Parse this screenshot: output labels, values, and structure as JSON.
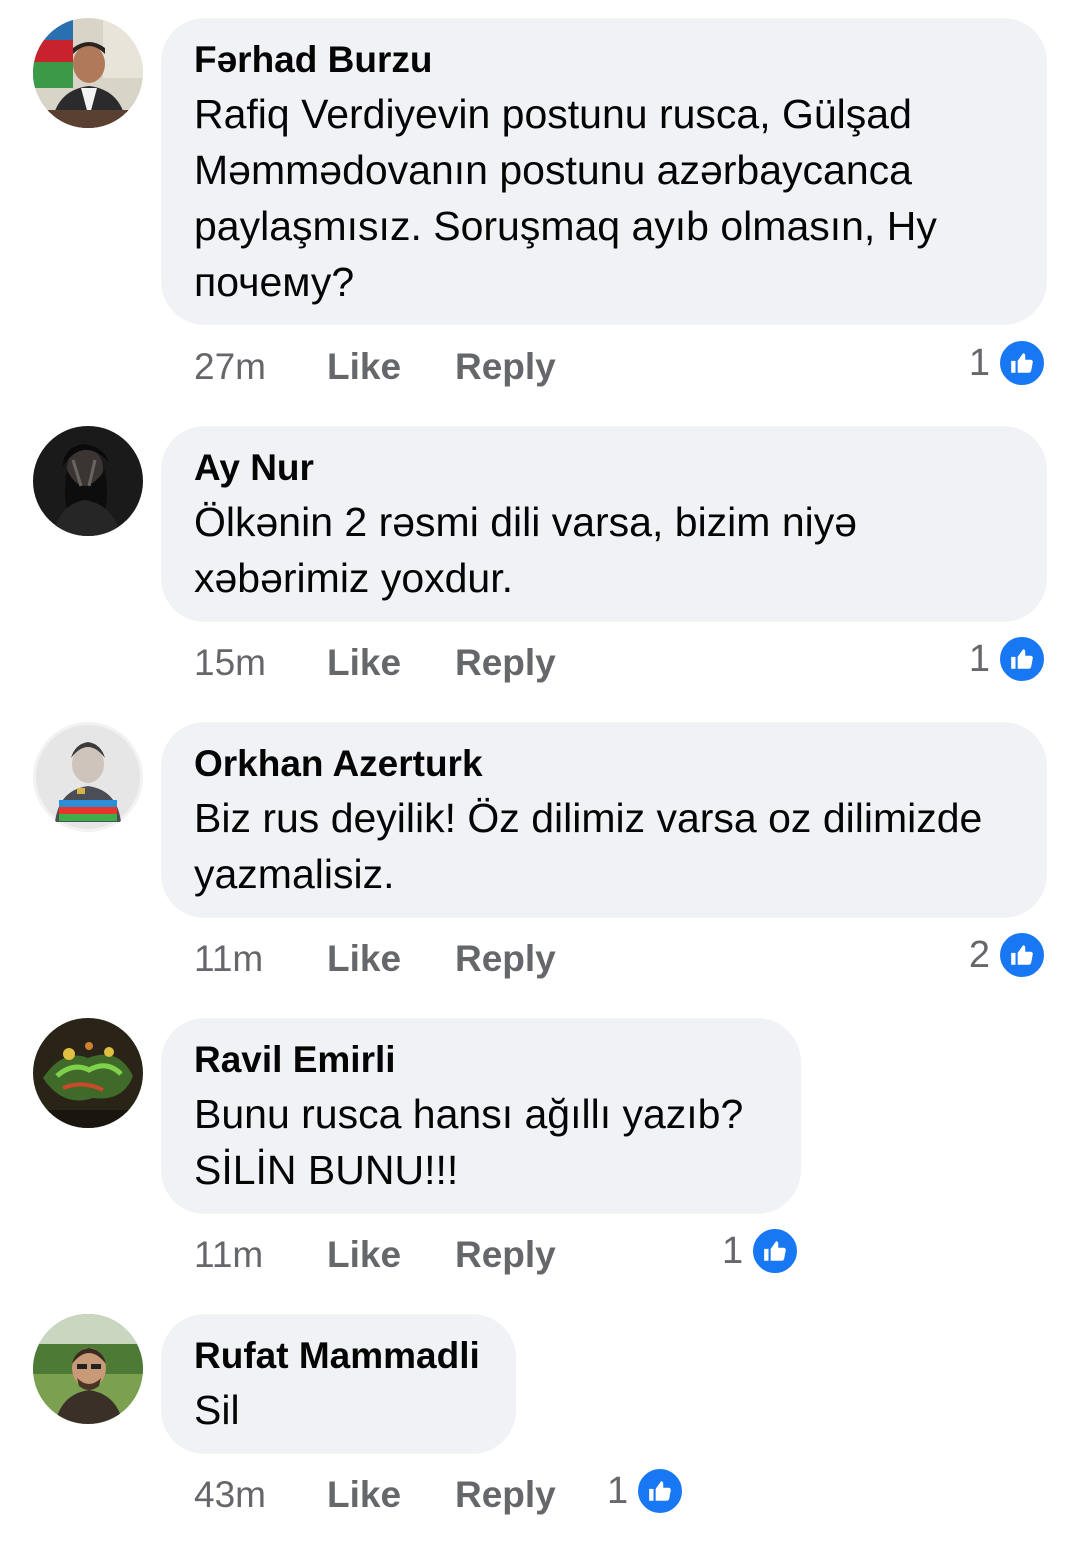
{
  "comments": [
    {
      "author": "Fərhad Burzu",
      "text": "Rafiq Verdiyevin postunu rusca, Gülşad Məmmədovanın postunu azərbaycanca paylaşmısız. Soruşmaq ayıb olmasın, Ну почему?",
      "time": "27m",
      "like_label": "Like",
      "reply_label": "Reply",
      "reaction_count": "1",
      "reaction_icon": "thumbs-up-icon"
    },
    {
      "author": "Ay Nur",
      "text": "Ölkənin 2 rəsmi dili varsa, bizim niyə xəbərimiz yoxdur.",
      "time": "15m",
      "like_label": "Like",
      "reply_label": "Reply",
      "reaction_count": "1",
      "reaction_icon": "thumbs-up-icon"
    },
    {
      "author": "Orkhan Azerturk",
      "text": "Biz rus deyilik! Öz dilimiz varsa oz dilimizde yazmalisiz.",
      "time": "11m",
      "like_label": "Like",
      "reply_label": "Reply",
      "reaction_count": "2",
      "reaction_icon": "thumbs-up-icon"
    },
    {
      "author": "Ravil Emirli",
      "text": "Bunu rusca hansı ağıllı yazıb? SİLİN BUNU!!!",
      "time": "11m",
      "like_label": "Like",
      "reply_label": "Reply",
      "reaction_count": "1",
      "reaction_icon": "thumbs-up-icon"
    },
    {
      "author": "Rufat Mammadli",
      "text": "Sil",
      "time": "43m",
      "like_label": "Like",
      "reply_label": "Reply",
      "reaction_count": "1",
      "reaction_icon": "thumbs-up-icon"
    }
  ],
  "colors": {
    "bubble_background": "#f0f2f5",
    "secondary_text": "#65676b",
    "like_blue": "#1877f2"
  }
}
